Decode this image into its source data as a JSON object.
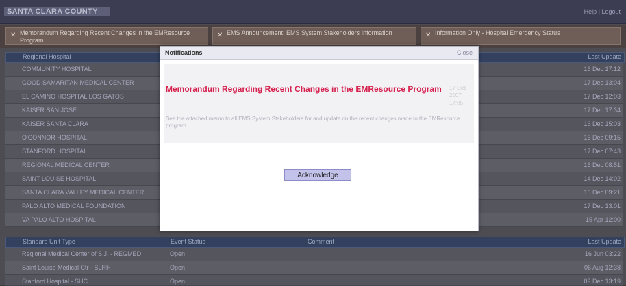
{
  "header": {
    "brand": "SANTA CLARA COUNTY",
    "links": "Help  |  Logout"
  },
  "tabs": [
    {
      "label": "Memorandum Regarding Recent Changes in the EMResource Program"
    },
    {
      "label": "EMS Announcement: EMS System Stakeholders Information"
    },
    {
      "label": "Information Only - Hospital Emergency Status"
    }
  ],
  "table1": {
    "headers": [
      "Regional Hospital",
      "Last Update"
    ],
    "rows": [
      {
        "name": "COMMUNITY HOSPITAL",
        "date": "16 Dec 17:12"
      },
      {
        "name": "GOOD SAMARITAN MEDICAL CENTER",
        "date": "17 Dec 13:04"
      },
      {
        "name": "EL CAMINO HOSPITAL LOS GATOS",
        "date": "17 Dec 12:03"
      },
      {
        "name": "KAISER SAN JOSE",
        "date": "17 Dec 17:34"
      },
      {
        "name": "KAISER SANTA CLARA",
        "date": "16 Dec 15:03"
      },
      {
        "name": "O'CONNOR HOSPITAL",
        "date": "16 Dec 09:15"
      },
      {
        "name": "STANFORD HOSPITAL",
        "date": "17 Dec 07:43"
      },
      {
        "name": "REGIONAL MEDICAL CENTER",
        "date": "16 Dec 08:51"
      },
      {
        "name": "SAINT LOUISE HOSPITAL",
        "date": "14 Dec 14:02"
      },
      {
        "name": "SANTA CLARA VALLEY MEDICAL CENTER",
        "date": "16 Dec 09:21"
      },
      {
        "name": "PALO ALTO MEDICAL FOUNDATION",
        "date": "17 Dec 13:01"
      },
      {
        "name": "VA PALO ALTO HOSPITAL",
        "date": "15 Apr 12:00"
      }
    ]
  },
  "table2": {
    "headers": [
      "Standard Unit Type",
      "Event Status",
      "Comment",
      "Last Update"
    ],
    "rows": [
      {
        "name": "Regional Medical Center of S.J. - REGMED",
        "status": "Open",
        "date": "16 Jun 03:22"
      },
      {
        "name": "Saint Louise Medical Ctr - SLRH",
        "status": "Open",
        "date": "06 Aug 12:38"
      },
      {
        "name": "Stanford Hospital - SHC",
        "status": "Open",
        "date": "09 Dec 13:19"
      }
    ]
  },
  "modal": {
    "title": "Notifications",
    "close_label": "Close",
    "notice_title": "Memorandum Regarding Recent Changes in the EMResource Program",
    "notice_date": "17 Dec 2007 17:05",
    "notice_text": "See the attached memo to all EMS System Stakeholders for and update on the recent changes made to the EMResource program.",
    "ack_label": "Acknowledge"
  }
}
